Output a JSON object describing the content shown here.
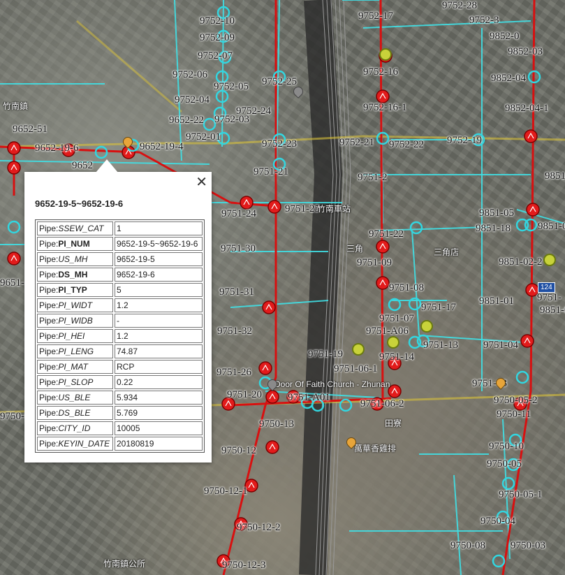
{
  "popup": {
    "title": "9652-19-5~9652-19-6",
    "close_icon": "close-icon",
    "rows": [
      {
        "prefix": "Pipe:",
        "field": "SSEW_CAT",
        "bold": false,
        "value": "1"
      },
      {
        "prefix": "Pipe:",
        "field": "PI_NUM",
        "bold": true,
        "value": "9652-19-5~9652-19-6"
      },
      {
        "prefix": "Pipe:",
        "field": "US_MH",
        "bold": false,
        "value": "9652-19-5"
      },
      {
        "prefix": "Pipe:",
        "field": "DS_MH",
        "bold": true,
        "value": "9652-19-6"
      },
      {
        "prefix": "Pipe:",
        "field": "PI_TYP",
        "bold": true,
        "value": "5"
      },
      {
        "prefix": "Pipe:",
        "field": "PI_WIDT",
        "bold": false,
        "value": "1.2"
      },
      {
        "prefix": "Pipe:",
        "field": "PI_WIDB",
        "bold": false,
        "value": "-"
      },
      {
        "prefix": "Pipe:",
        "field": "PI_HEI",
        "bold": false,
        "value": "1.2"
      },
      {
        "prefix": "Pipe:",
        "field": "PI_LENG",
        "bold": false,
        "value": "74.87"
      },
      {
        "prefix": "Pipe:",
        "field": "PI_MAT",
        "bold": false,
        "value": "RCP"
      },
      {
        "prefix": "Pipe:",
        "field": "PI_SLOP",
        "bold": false,
        "value": "0.22"
      },
      {
        "prefix": "Pipe:",
        "field": "US_BLE",
        "bold": false,
        "value": "5.934"
      },
      {
        "prefix": "Pipe:",
        "field": "DS_BLE",
        "bold": false,
        "value": "5.769"
      },
      {
        "prefix": "Pipe:",
        "field": "CITY_ID",
        "bold": false,
        "value": "10005"
      },
      {
        "prefix": "Pipe:",
        "field": "KEYIN_DATE",
        "bold": false,
        "value": "20180819"
      }
    ]
  },
  "map": {
    "colors": {
      "pipe_red": "#d81010",
      "pipe_cyan": "#3fe0e6",
      "manhole_red": "#e21b1b",
      "manhole_cyan": "#32d6e0",
      "road_yellow": "#d9c23a"
    },
    "labels": [
      {
        "id": "l1",
        "text": "9752-10"
      },
      {
        "id": "l2",
        "text": "9752-09"
      },
      {
        "id": "l3",
        "text": "9752-07"
      },
      {
        "id": "l4",
        "text": "9752-06"
      },
      {
        "id": "l5",
        "text": "9752-05"
      },
      {
        "id": "l6",
        "text": "9752-04"
      },
      {
        "id": "l7",
        "text": "9752-03"
      },
      {
        "id": "l8",
        "text": "9752-01"
      },
      {
        "id": "l9",
        "text": "9652-22"
      },
      {
        "id": "l10",
        "text": "9752-25"
      },
      {
        "id": "l11",
        "text": "9752-24"
      },
      {
        "id": "l12",
        "text": "9752-23"
      },
      {
        "id": "l13",
        "text": "9752-17"
      },
      {
        "id": "l14",
        "text": "9752-16"
      },
      {
        "id": "l15",
        "text": "9752-16-1"
      },
      {
        "id": "l16",
        "text": "9752-21"
      },
      {
        "id": "l17",
        "text": "9752-22"
      },
      {
        "id": "l18",
        "text": "9752-19"
      },
      {
        "id": "l19",
        "text": "9752-28"
      },
      {
        "id": "l20",
        "text": "9752-3"
      },
      {
        "id": "l21",
        "text": "9852-0"
      },
      {
        "id": "l22",
        "text": "9852-03"
      },
      {
        "id": "l23",
        "text": "9852-04"
      },
      {
        "id": "l24",
        "text": "9852-04-1"
      },
      {
        "id": "l25",
        "text": "9652-51"
      },
      {
        "id": "l26",
        "text": "9652-19-6"
      },
      {
        "id": "l27",
        "text": "9652-19-4"
      },
      {
        "id": "l28",
        "text": "9652"
      },
      {
        "id": "l29",
        "text": "9751-21"
      },
      {
        "id": "l30",
        "text": "9751-24"
      },
      {
        "id": "l31",
        "text": "9751-25"
      },
      {
        "id": "l32",
        "text": "9751-30"
      },
      {
        "id": "l33",
        "text": "9751-31"
      },
      {
        "id": "l34",
        "text": "9751-32"
      },
      {
        "id": "l35",
        "text": "9751-26"
      },
      {
        "id": "l36",
        "text": "9751-2"
      },
      {
        "id": "l37",
        "text": "9751-22"
      },
      {
        "id": "l38",
        "text": "9751-09"
      },
      {
        "id": "l39",
        "text": "9751-08"
      },
      {
        "id": "l40",
        "text": "9751-17"
      },
      {
        "id": "l41",
        "text": "9751-A06"
      },
      {
        "id": "l42",
        "text": "9751-07"
      },
      {
        "id": "l43",
        "text": "9751-13"
      },
      {
        "id": "l44",
        "text": "9751-14"
      },
      {
        "id": "l45",
        "text": "9751-06-1"
      },
      {
        "id": "l46",
        "text": "9751-A01"
      },
      {
        "id": "l47",
        "text": "9751-06-2"
      },
      {
        "id": "l48",
        "text": "9751-20"
      },
      {
        "id": "l49",
        "text": "9751-19"
      },
      {
        "id": "l50",
        "text": "9851-05"
      },
      {
        "id": "l51",
        "text": "9851-18"
      },
      {
        "id": "l52",
        "text": "9851-0"
      },
      {
        "id": "l53",
        "text": "9851-02-2"
      },
      {
        "id": "l54",
        "text": "9851-01"
      },
      {
        "id": "l55",
        "text": "9851-0"
      },
      {
        "id": "l56",
        "text": "9751-04"
      },
      {
        "id": "l57",
        "text": "9751-03"
      },
      {
        "id": "l58",
        "text": "9851-"
      },
      {
        "id": "l59",
        "text": "9750-05-2"
      },
      {
        "id": "l60",
        "text": "9750-11"
      },
      {
        "id": "l61",
        "text": "9750-13"
      },
      {
        "id": "l62",
        "text": "9750-12"
      },
      {
        "id": "l63",
        "text": "9750-12-1"
      },
      {
        "id": "l64",
        "text": "9750-12-2"
      },
      {
        "id": "l65",
        "text": "9750-12-3"
      },
      {
        "id": "l66",
        "text": "9750-10"
      },
      {
        "id": "l67",
        "text": "9750-05"
      },
      {
        "id": "l68",
        "text": "9750-05-1"
      },
      {
        "id": "l69",
        "text": "9750-04"
      },
      {
        "id": "l70",
        "text": "9750-08"
      },
      {
        "id": "l71",
        "text": "9750-03"
      },
      {
        "id": "l72",
        "text": "9651-"
      },
      {
        "id": "l73",
        "text": "9750-06"
      },
      {
        "id": "l74",
        "text": "9751-"
      }
    ],
    "places": [
      {
        "id": "p1",
        "text": "竹南鎮"
      },
      {
        "id": "p2",
        "text": "三角"
      },
      {
        "id": "p3",
        "text": "三角店"
      },
      {
        "id": "p4",
        "text": "田寮"
      },
      {
        "id": "p5",
        "text": "Door Of Faith Church - Zhunan"
      },
      {
        "id": "p6",
        "text": "萬華香雞排"
      },
      {
        "id": "p7",
        "text": "竹南車站"
      },
      {
        "id": "p8",
        "text": "竹南鎮公所"
      }
    ],
    "shield": "124"
  }
}
